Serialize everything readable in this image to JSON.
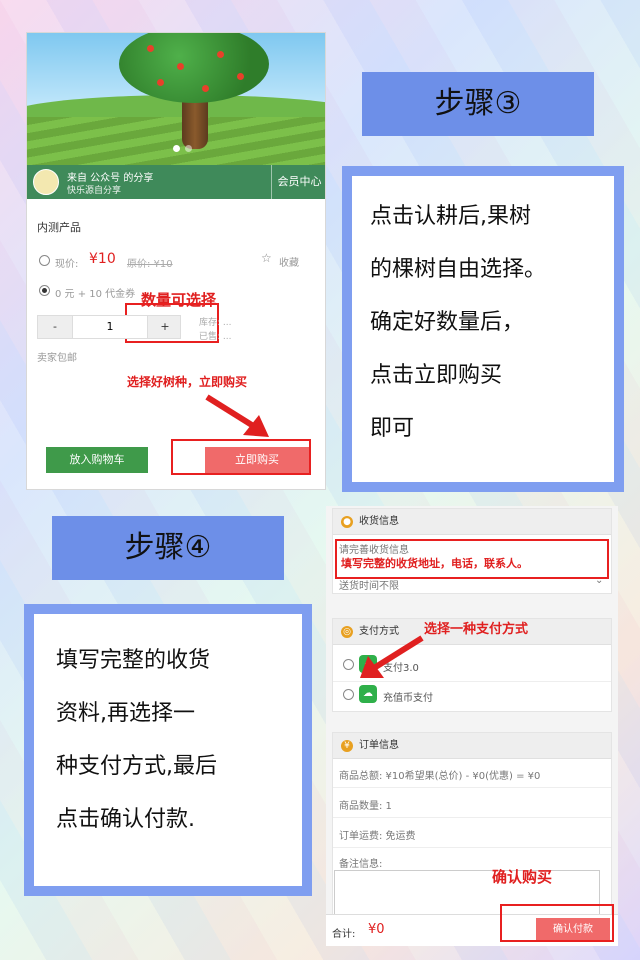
{
  "panel1": {
    "share_from": "来自 公众号 的分享",
    "share_sub": "快乐源自分享",
    "member_center": "会员中心",
    "product_name": "内测产品",
    "now_price_label": "现价:",
    "now_price": "¥10",
    "orig_price": "原价: ¥10",
    "favorite": "收藏",
    "coupon_option": "0 元 + 10 代金券",
    "qty_minus": "-",
    "qty_value": "1",
    "qty_plus": "+",
    "stock_label": "库存: ...",
    "sold_label": "已售: ...",
    "shipping": "卖家包邮",
    "add_cart": "放入购物车",
    "buy_now": "立即购买",
    "annotation_qty": "数量可选择",
    "annotation_buy": "选择好树种，立即购买"
  },
  "step3": {
    "title": "步骤③",
    "lines": [
      "点击认耕后,果树",
      "的棵树自由选择。",
      "确定好数量后，",
      "点击立即购买",
      "即可"
    ]
  },
  "step4": {
    "title": "步骤④",
    "lines": [
      "填写完整的收货",
      "资料,再选择一",
      "种支付方式,最后",
      "点击确认付款."
    ]
  },
  "panel2": {
    "shipping_header": "收货信息",
    "address_placeholder": "请完善收货信息",
    "delivery_time": "送货时间不限",
    "annotation_address": "填写完整的收货地址，电话，联系人。",
    "payment_header": "支付方式",
    "annotation_payment": "选择一种支付方式",
    "pay_option_1": "支付3.0",
    "pay_option_2": "充值币支付",
    "order_header": "订单信息",
    "order_total": "商品总额: ¥10希望果(总价) - ¥0(优惠) = ¥0",
    "order_qty": "商品数量: 1",
    "order_shipping": "订单运费: 免运费",
    "order_note": "备注信息:",
    "annotation_confirm": "确认购买",
    "total_label": "合计:",
    "total_value": "¥0",
    "confirm_pay": "确认付款"
  },
  "colors": {
    "accent_red": "#e02020",
    "panel_blue": "#7f9ef0",
    "green_bar": "#3f8a5a"
  },
  "icons": [
    "person-icon",
    "star-icon",
    "wallet-icon",
    "yen-icon",
    "wechat-pay-icon",
    "cloud-coin-icon",
    "arrow-icon"
  ]
}
